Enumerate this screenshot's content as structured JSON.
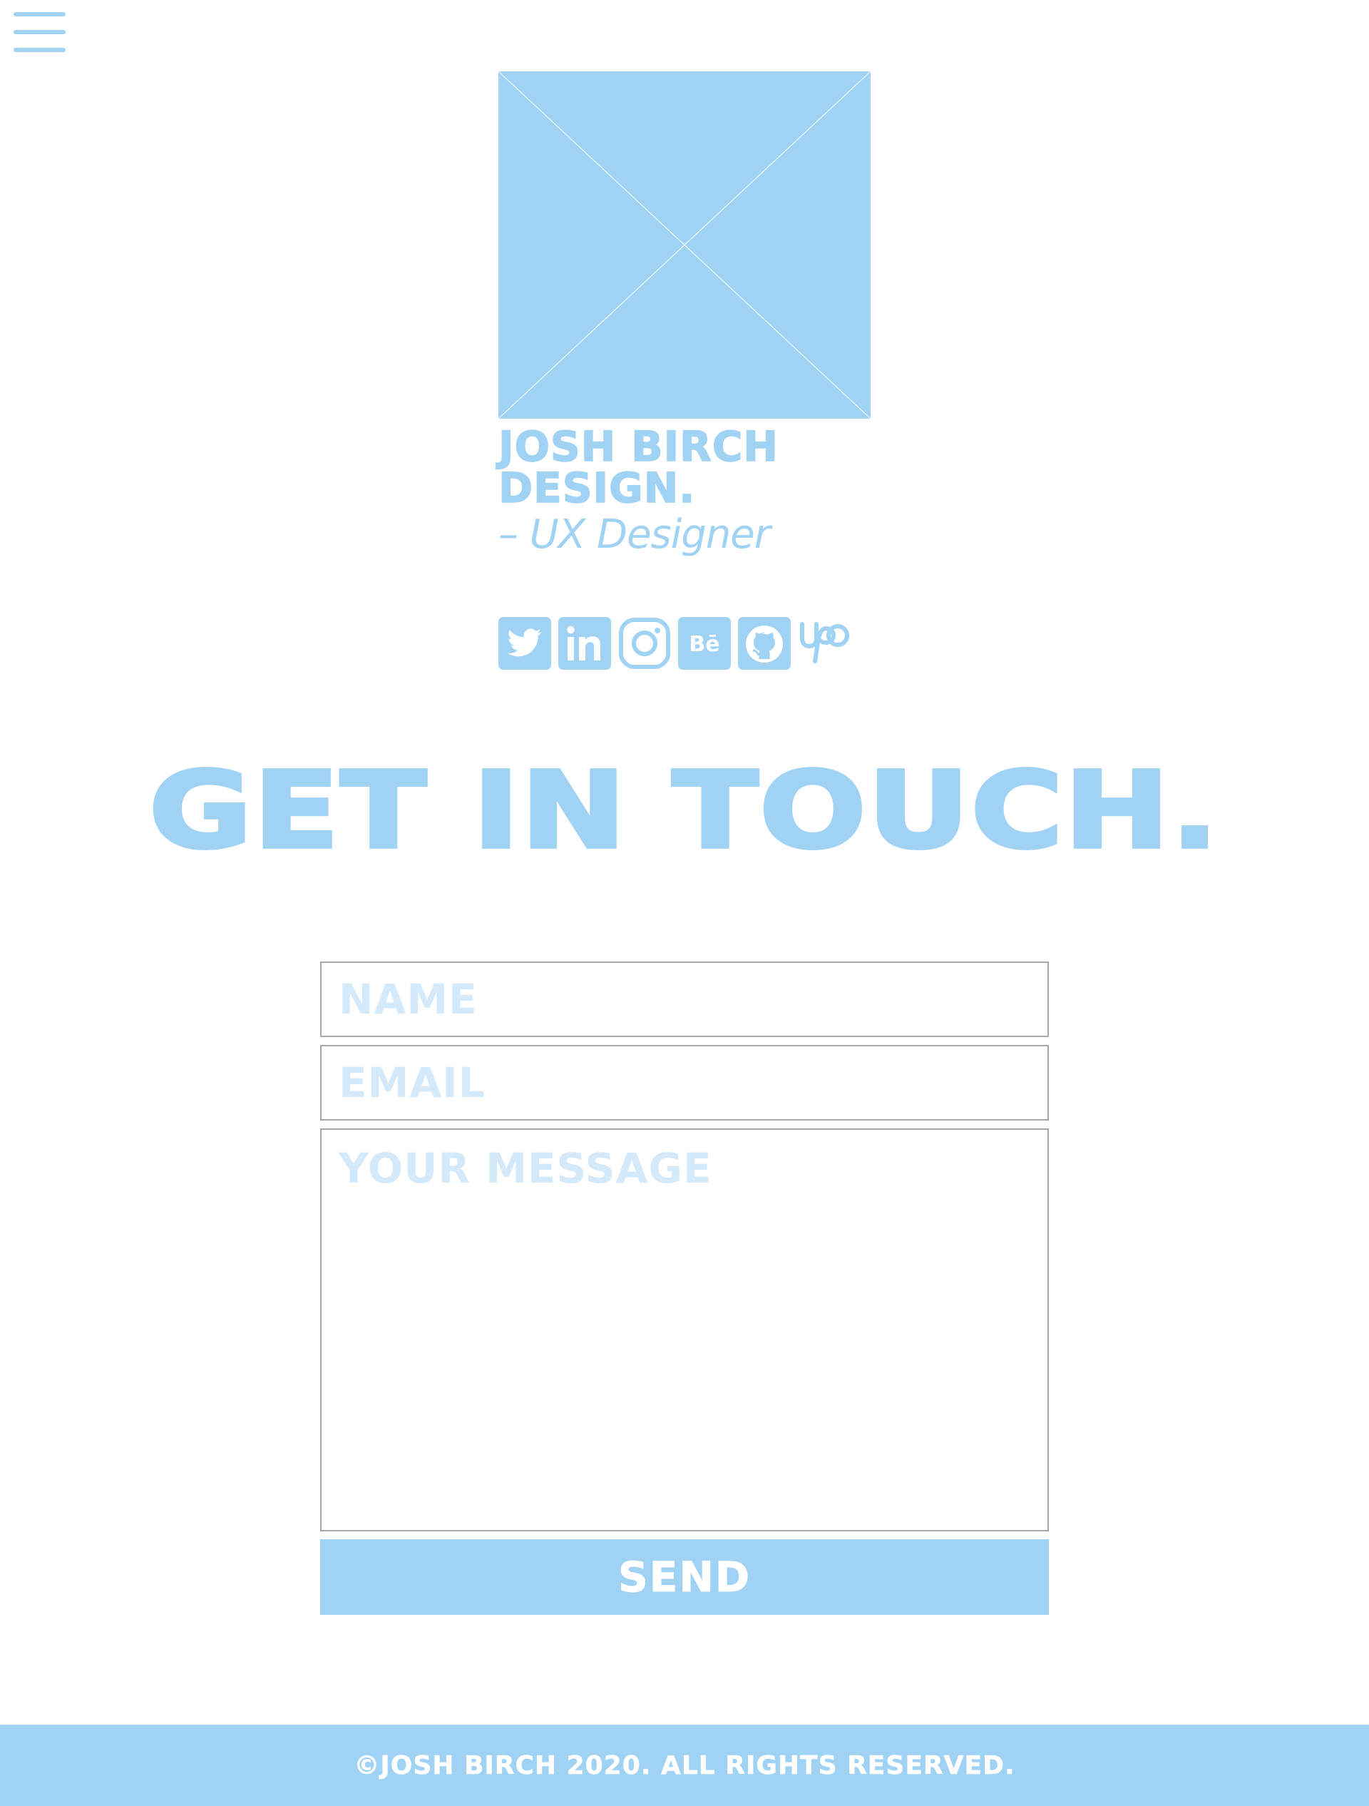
{
  "colors": {
    "accent": "#a0d2f4",
    "placeholder_text": "#d4eafb",
    "field_border": "#a8a8a8",
    "background": "#ffffff",
    "footer_text": "#ffffff"
  },
  "nav": {
    "menu_icon": "hamburger-menu-icon"
  },
  "profile": {
    "image_icon": "image-placeholder-icon",
    "name_line1": "JOSH BIRCH",
    "name_line2": "DESIGN.",
    "role": "– UX Designer"
  },
  "social": [
    {
      "icon": "twitter-icon"
    },
    {
      "icon": "linkedin-icon"
    },
    {
      "icon": "instagram-icon"
    },
    {
      "icon": "behance-icon"
    },
    {
      "icon": "github-icon"
    },
    {
      "icon": "upwork-icon"
    }
  ],
  "contact": {
    "heading": "GET IN TOUCH.",
    "name_placeholder": "NAME",
    "email_placeholder": "EMAIL",
    "message_placeholder": "YOUR MESSAGE",
    "send_label": "SEND"
  },
  "footer": {
    "text": "©JOSH BIRCH 2020. ALL RIGHTS RESERVED."
  }
}
